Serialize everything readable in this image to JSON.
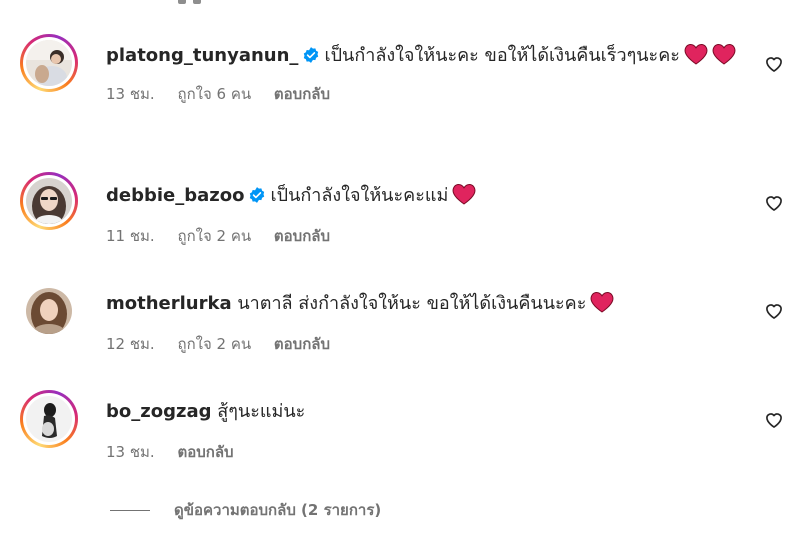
{
  "comments": [
    {
      "username": "platong_tunyanun_",
      "verified": true,
      "story_ring": true,
      "text": "เป็นกำลังใจให้นะคะ ขอให้ได้เงินคืนเร็วๆนะคะ",
      "emoji": [
        "red-heart",
        "red-heart"
      ],
      "time": "13 ชม.",
      "likes": "ถูกใจ 6 คน",
      "reply": "ตอบกลับ"
    },
    {
      "username": "debbie_bazoo",
      "verified": true,
      "story_ring": true,
      "text": "เป็นกำลังใจให้นะคะแม่",
      "emoji": [
        "red-heart"
      ],
      "time": "11 ชม.",
      "likes": "ถูกใจ 2 คน",
      "reply": "ตอบกลับ"
    },
    {
      "username": "motherlurka",
      "verified": false,
      "story_ring": false,
      "text": "นาตาลี ส่งกำลังใจให้นะ ขอให้ได้เงินคืนนะคะ",
      "emoji": [
        "red-heart"
      ],
      "time": "12 ชม.",
      "likes": "ถูกใจ 2 คน",
      "reply": "ตอบกลับ"
    },
    {
      "username": "bo_zogzag",
      "verified": false,
      "story_ring": true,
      "text": "สู้ๆนะแม่นะ",
      "emoji": [],
      "time": "13 ชม.",
      "reply": "ตอบกลับ"
    }
  ],
  "view_replies": "ดูข้อความตอบกลับ (2 รายการ)",
  "colors": {
    "text": "#262626",
    "secondary": "#737373",
    "verified": "#0095f6",
    "heart": "#e0245e"
  }
}
